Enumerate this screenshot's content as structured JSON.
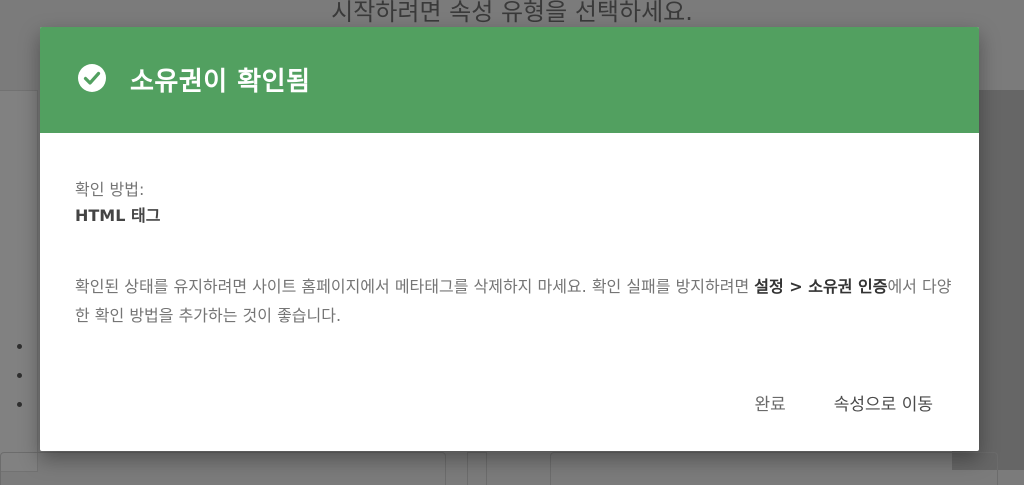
{
  "background": {
    "heading": "시작하려면 속성 유형을 선택하세요."
  },
  "dialog": {
    "icon": "check-circle-icon",
    "title": "소유권이 확인됨",
    "method_label": "확인 방법:",
    "method_value": "HTML 태그",
    "description_part1": "확인된 상태를 유지하려면 사이트 홈페이지에서 메타태그를 삭제하지 마세요. 확인 실패를 방지하려면 ",
    "description_bold": "설정 > 소유권 인증",
    "description_part2": "에서 다양한 확인 방법을 추가하는 것이 좋습니다.",
    "done_label": "완료",
    "go_label": "속성으로 이동"
  },
  "colors": {
    "header_green": "#52a060",
    "overlay": "#7b7b7b",
    "text_gray": "#757575"
  }
}
